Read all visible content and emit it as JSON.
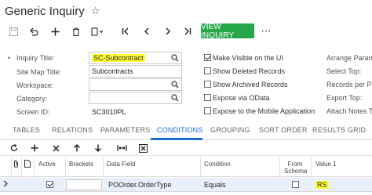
{
  "header": {
    "title": "Generic Inquiry"
  },
  "toolbar": {
    "view_inquiry_label": "VIEW INQUIRY",
    "more_label": "⋯"
  },
  "form": {
    "inquiry_title_label": "Inquiry Title:",
    "inquiry_title_value": "SC-Subcontract",
    "site_map_title_label": "Site Map Title:",
    "site_map_title_value": "Subcontracts",
    "workspace_label": "Workspace:",
    "workspace_value": "",
    "category_label": "Category:",
    "category_value": "",
    "screen_id_label": "Screen ID:",
    "screen_id_value": "SC3010PL",
    "checkboxes": [
      {
        "label": "Make Visible on the UI",
        "checked": true
      },
      {
        "label": "Show Deleted Records",
        "checked": false
      },
      {
        "label": "Show Archived Records",
        "checked": false
      },
      {
        "label": "Expose via OData",
        "checked": false
      },
      {
        "label": "Expose to the Mobile Application",
        "checked": false
      }
    ],
    "right_labels": [
      "Arrange Parame",
      "Select Top:",
      "Records per Pag",
      "Export Top:",
      "Attach Notes To"
    ]
  },
  "tabs": [
    "TABLES",
    "RELATIONS",
    "PARAMETERS",
    "CONDITIONS",
    "GROUPING",
    "SORT ORDER",
    "RESULTS GRID"
  ],
  "active_tab": "CONDITIONS",
  "grid": {
    "columns": {
      "active": "Active",
      "brackets": "Brackets",
      "data_field": "Data Field",
      "condition": "Condition",
      "from_schema_1": "From",
      "from_schema_2": "Schema",
      "value1": "Value 1"
    },
    "rows": [
      {
        "active": true,
        "brackets": "",
        "data_field": "POOrder.OrderType",
        "condition": "Equals",
        "from_schema": false,
        "value1": "RS"
      }
    ]
  },
  "colors": {
    "accent": "#1a6fd1",
    "primary_button": "#26a74a",
    "highlight": "#ffff33",
    "selected_row": "#e8f1fb"
  }
}
